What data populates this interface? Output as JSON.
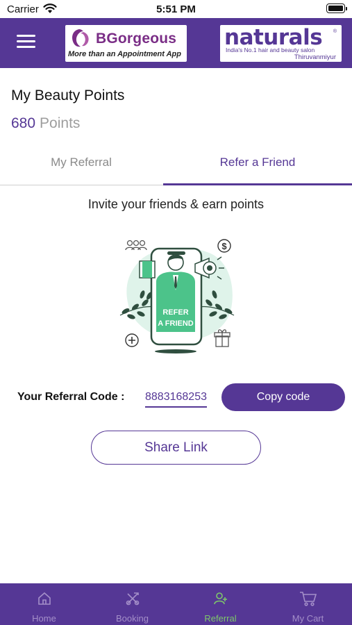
{
  "status_bar": {
    "carrier": "Carrier",
    "time": "5:51 PM"
  },
  "header": {
    "bgorgeous": {
      "name": "BGorgeous",
      "tagline": "More than an Appointment App"
    },
    "naturals": {
      "name": "naturals",
      "tagline": "India's No.1 hair and beauty salon",
      "location": "Thiruvanmiyur"
    }
  },
  "points": {
    "heading": "My Beauty Points",
    "value": "680",
    "unit": "Points"
  },
  "tabs": [
    {
      "label": "My Referral",
      "active": false
    },
    {
      "label": "Refer a Friend",
      "active": true
    }
  ],
  "refer": {
    "invite_text": "Invite your friends & earn points",
    "illustration_text": [
      "REFER",
      "A FRIEND"
    ],
    "code_label": "Your Referral Code :",
    "code_value": "8883168253",
    "copy_button": "Copy code",
    "share_button": "Share Link"
  },
  "bottom_nav": [
    {
      "label": "Home",
      "icon": "home-icon",
      "active": false
    },
    {
      "label": "Booking",
      "icon": "booking-tools-icon",
      "active": false
    },
    {
      "label": "Referral",
      "icon": "referral-user-icon",
      "active": true
    },
    {
      "label": "My Cart",
      "icon": "cart-icon",
      "active": false
    }
  ],
  "colors": {
    "brand": "#553795",
    "active_nav": "#7ec86a",
    "inactive_nav": "#a48fc9",
    "illustration_green": "#4cc38a"
  }
}
